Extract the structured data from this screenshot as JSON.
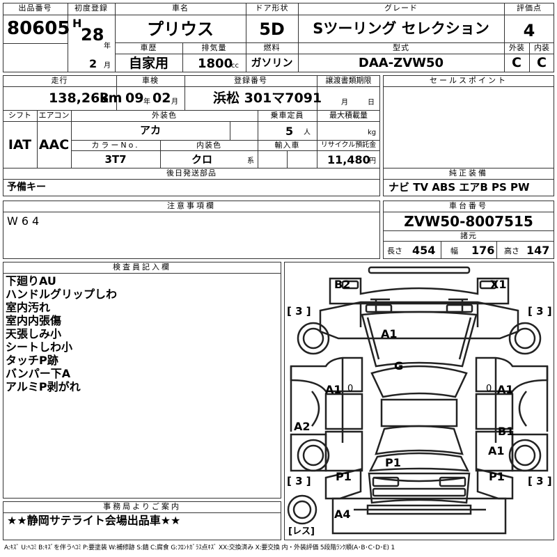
{
  "header": {
    "lot_number_label": "出品番号",
    "lot_number": "80605",
    "first_reg_label": "初度登録",
    "era": "H",
    "reg_year": "28",
    "year_unit": "年",
    "reg_month": "2",
    "month_unit": "月",
    "car_name_label": "車名",
    "car_name": "プリウス",
    "door_label": "ドア形状",
    "door": "5D",
    "grade_label": "グレード",
    "grade": "Sツーリング セレクション",
    "score_label": "評価点",
    "score": "4",
    "history_label": "車歴",
    "history": "自家用",
    "displacement_label": "排気量",
    "displacement": "1800",
    "displacement_unit": "cc",
    "fuel_label": "燃料",
    "fuel": "ガソリン",
    "model_label": "型式",
    "model": "DAA-ZVW50",
    "exterior_label": "外装",
    "exterior": "C",
    "interior_label": "内装",
    "interior": "C"
  },
  "details": {
    "mileage_label": "走行",
    "mileage": "138,263",
    "mileage_unit": "km",
    "inspection_label": "車検",
    "insp_year": "09",
    "insp_year_unit": "年",
    "insp_month": "02",
    "insp_month_unit": "月",
    "plate_label": "登録番号",
    "plate": "浜松 301マ7091",
    "transfer_label": "譲渡書類期限",
    "transfer_month_unit": "月",
    "transfer_day_unit": "日",
    "shift_label": "シフト",
    "shift": "IAT",
    "ac_label": "エアコン",
    "ac": "AAC",
    "ext_color_label": "外装色",
    "ext_color": "アカ",
    "capacity_label": "乗車定員",
    "capacity": "5",
    "capacity_unit": "人",
    "max_load_label": "最大積載量",
    "max_load_unit": "kg",
    "color_no_label": "カラーNo.",
    "color_no": "3T7",
    "int_color_label": "内装色",
    "int_color": "クロ",
    "int_color_unit": "系",
    "import_label": "輸入車",
    "recycle_label": "リサイクル預託金",
    "recycle": "11,480",
    "recycle_unit": "円",
    "parts_label": "後日発送部品",
    "parts": "予備キー"
  },
  "sales": {
    "label": "セールスポイント",
    "text": ""
  },
  "equipment": {
    "label": "純正装備",
    "text": "ナビ TV ABS エアB PS PW"
  },
  "caution": {
    "label": "注意事項欄",
    "text": "W64"
  },
  "chassis": {
    "label": "車台番号",
    "number": "ZVW50-8007515",
    "dims_label": "諸元",
    "length_label": "長さ",
    "length": "454",
    "width_label": "幅",
    "width": "176",
    "height_label": "高さ",
    "height": "147"
  },
  "inspector": {
    "label": "検査員記入欄",
    "notes": [
      "下廻りAU",
      "ハンドルグリップしわ",
      "室内汚れ",
      "室内内張傷",
      "天張しみ小",
      "シートしわ小",
      "タッチP跡",
      "バンパー下A",
      "アルミP剥がれ"
    ]
  },
  "office": {
    "label": "事務局よりご案内",
    "text": "★★静岡サテライト会場出品車★★"
  },
  "diagram": {
    "marks": {
      "b2": "B2",
      "x1": "X1",
      "a1_hood": "A1",
      "g": "G",
      "a1_left": "A1",
      "a1_right": "A1",
      "a2": "A2",
      "b1": "B1",
      "a1_rear": "A1",
      "p1_trunk": "P1",
      "p1_left": "P1",
      "p1_right": "P1",
      "a4": "A4"
    },
    "tire_fl": "[ 3 ]",
    "tire_fr": "[ 3 ]",
    "tire_rl": "[ 3 ]",
    "tire_rr": "[ 3 ]",
    "spare": "[レス]",
    "zero_l": "0",
    "zero_r": "0"
  },
  "footer": {
    "legend": "A:ｷｽﾞ U:ﾍｺﾐ B:ｷｽﾞを伴うﾍｺﾐ P:要塗装 W:補修跡 S:錆 C:腐食 G:ﾌﾛﾝﾄｶﾞﾗｽ点ｷｽﾞ XX:交換済み X:要交換 内・外装評価 5段階ﾗﾝｸ順(A･B･C･D･E) 1"
  }
}
